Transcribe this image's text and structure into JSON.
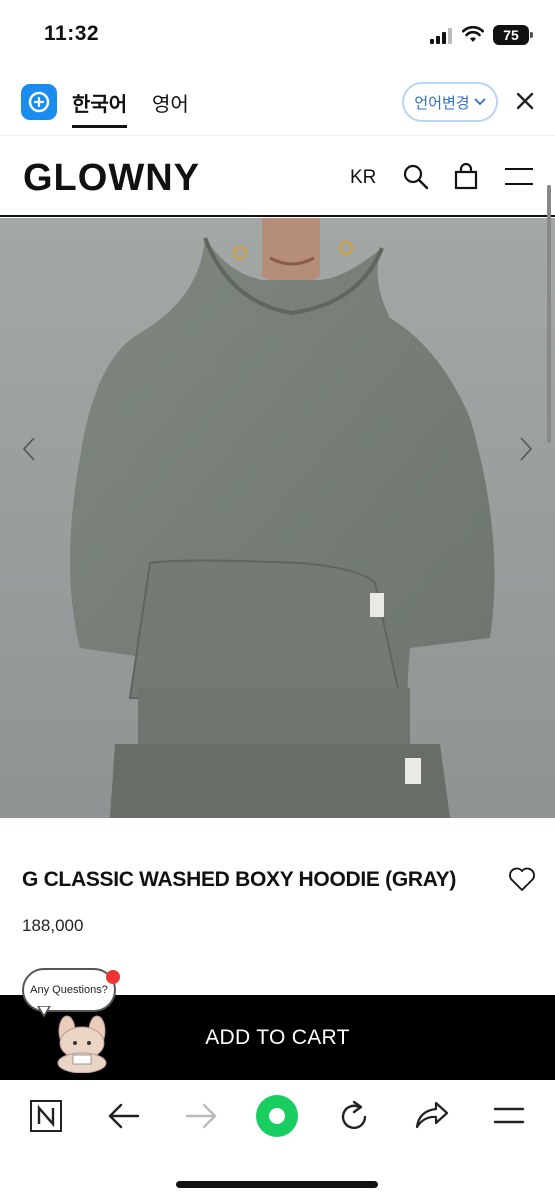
{
  "status_bar": {
    "time": "11:32",
    "battery": "75"
  },
  "translate_bar": {
    "tabs": [
      {
        "label": "한국어",
        "active": true
      },
      {
        "label": "영어",
        "active": false
      }
    ],
    "change_language_label": "언어변경"
  },
  "header": {
    "logo": "GLOWNY",
    "region": "KR",
    "icons": [
      "search-icon",
      "shopping-bag-icon",
      "hamburger-menu-icon"
    ]
  },
  "product": {
    "title": "G CLASSIC WASHED BOXY HOODIE (GRAY)",
    "price": "188,000",
    "image_color": "#9aa09e"
  },
  "chat_widget": {
    "bubble_text": "Any Questions?"
  },
  "cart": {
    "label": "ADD TO CART"
  },
  "browser_toolbar": {
    "icons": [
      "naver-icon",
      "back-arrow-icon",
      "forward-arrow-icon",
      "green-home-icon",
      "reload-icon",
      "share-icon",
      "menu-icon"
    ]
  },
  "colors": {
    "accent_blue": "#1a8cf0",
    "naver_green": "#19ce60",
    "cart_bg": "#000000"
  }
}
